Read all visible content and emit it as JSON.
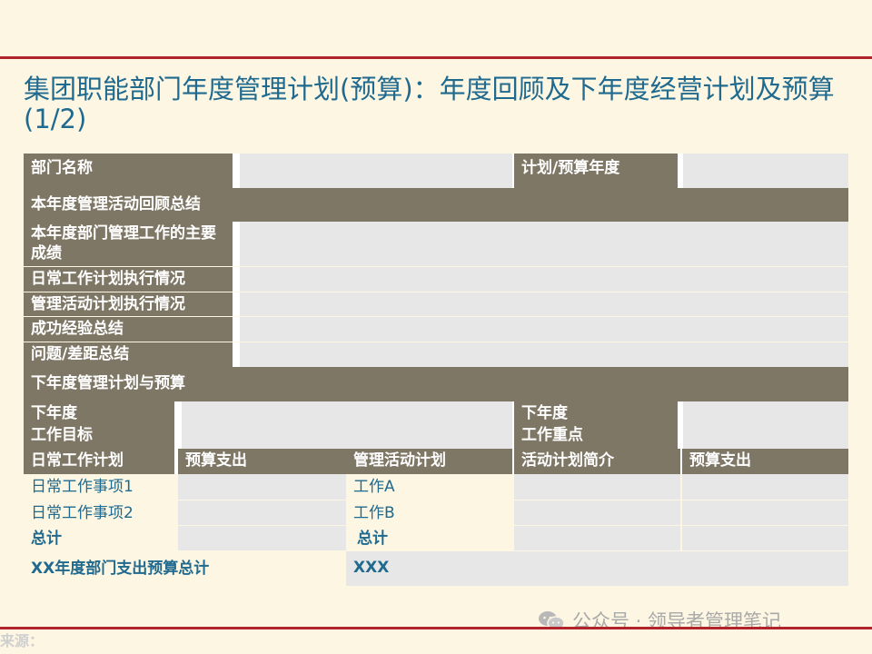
{
  "title": "集团职能部门年度管理计划(预算)：年度回顾及下年度经营计划及预算(1/2)",
  "table": {
    "dept_name_label": "部门名称",
    "plan_year_label": "计划/预算年度",
    "review_section": "本年度管理活动回顾总结",
    "main_achievements": "本年度部门管理工作的主要成绩",
    "daily_execution": "日常工作计划执行情况",
    "activity_execution": "管理活动计划执行情况",
    "success_summary": "成功经验总结",
    "problem_summary": "问题/差距总结",
    "next_section": "下年度管理计划与预算",
    "next_goal": "下年度\n工作目标",
    "next_focus": "下年度\n工作重点",
    "col_daily_plan": "日常工作计划",
    "col_budget1": "预算支出",
    "col_activity_plan": "管理活动计划",
    "col_activity_brief": "活动计划简介",
    "col_budget2": "预算支出",
    "daily_item1": "日常工作事项1",
    "daily_item2": "日常工作事项2",
    "total1": "总计",
    "work_a": "工作A",
    "work_b": "工作B",
    "total2": "总计",
    "dept_total_label": "XX年度部门支出预算总计",
    "dept_total_value": "XXX"
  },
  "footer": {
    "source": "来源：",
    "watermark": "公众号 · 领导者管理笔记"
  }
}
